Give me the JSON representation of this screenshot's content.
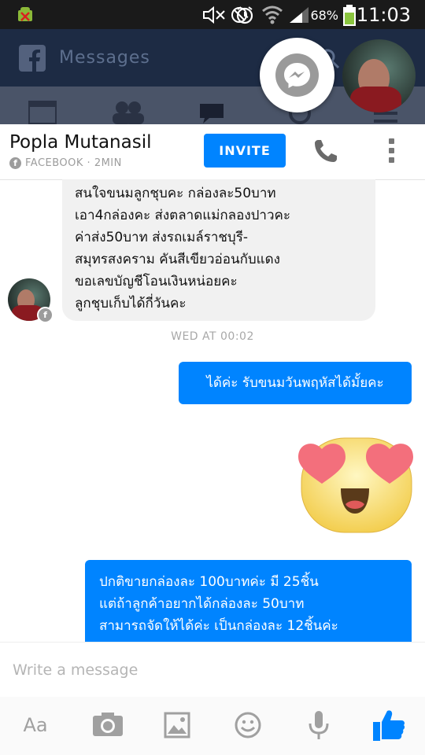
{
  "status_bar": {
    "battery_percent": "68%",
    "time": "11:03",
    "icons": [
      "android-debug-icon",
      "mute-icon",
      "no-signal-icon",
      "alarm-icon",
      "wifi-icon",
      "signal-icon",
      "battery-icon"
    ]
  },
  "fb_app": {
    "title": "Messages",
    "tabs": [
      "news-feed-icon",
      "friends-icon",
      "messages-icon",
      "notifications-icon",
      "more-icon"
    ]
  },
  "conversation": {
    "contact_name": "Popla Mutanasil",
    "source": "FACEBOOK · 2MIN",
    "invite_label": "INVITE",
    "incoming_lines": [
      "สนใจขนมลูกชุบคะ กล่องละ50บาท",
      "เอา4กล่องคะ ส่งตลาดแม่กลองปาวคะ",
      "ค่าส่ง50บาท ส่งรถเมล์ราชบุรี-",
      "สมุทรสงคราม คันสีเขียวอ่อนกับแดง",
      "ขอเลขบัญชีโอนเงินหน่อยคะ",
      "ลูกชุบเก็บได้กี่วันคะ"
    ],
    "timestamp": "WED AT 00:02",
    "outgoing_1": "ได้ค่ะ รับขนมวันพฤหัสได้มั้ยคะ",
    "outgoing_2_lines": [
      "ปกติขายกล่องละ 100บาทค่ะ มี 25ชิ้น",
      "แต่ถ้าลูกค้าอยากได้กล่องละ 50บาท",
      "สามารถจัดให้ได้ค่ะ เป็นกล่องละ 12ชิ้นค่ะ"
    ]
  },
  "composer": {
    "placeholder": "Write a message"
  },
  "toolbar": {
    "text_label": "Aa",
    "icons": [
      "text-icon",
      "camera-icon",
      "gallery-icon",
      "emoji-icon",
      "microphone-icon",
      "like-icon"
    ]
  },
  "colors": {
    "messenger_blue": "#0084ff",
    "fb_dark_header": "#1d2b44",
    "incoming_bubble": "#f1f1f1"
  }
}
